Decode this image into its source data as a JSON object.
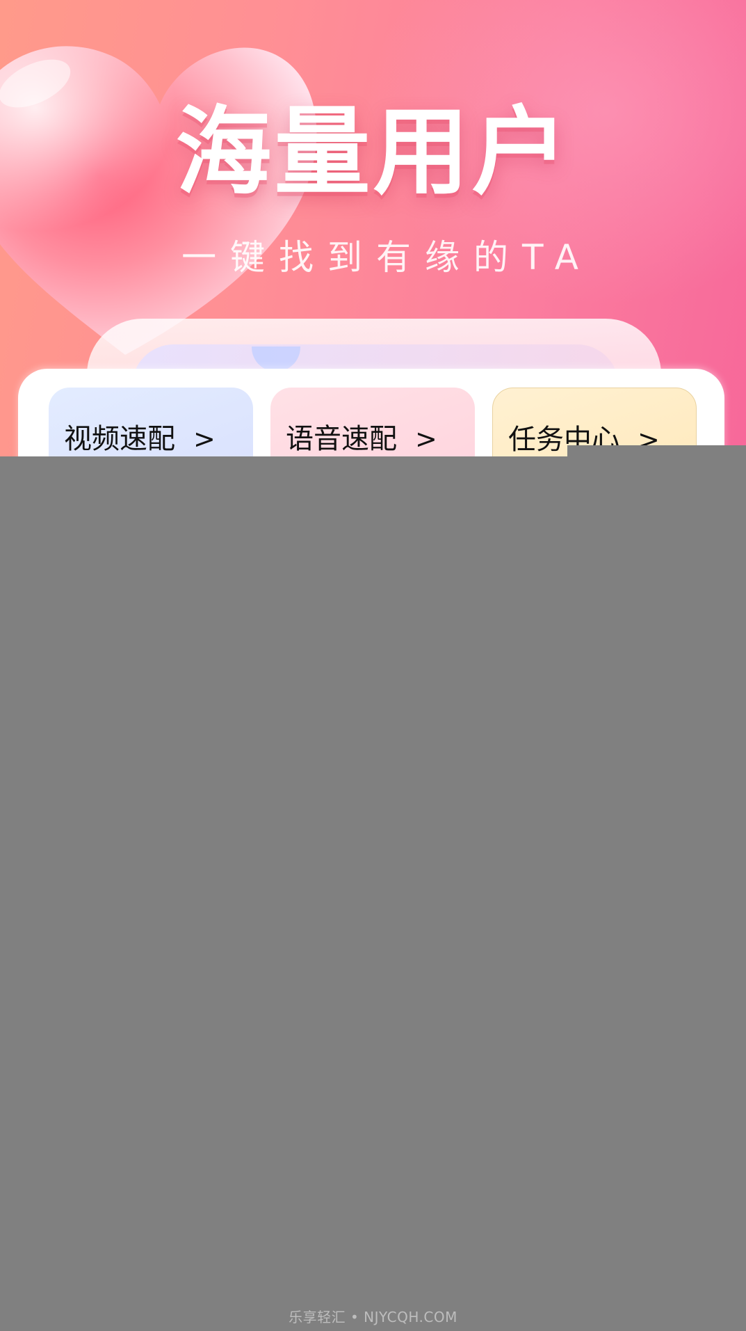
{
  "hero": {
    "title": "海量用户",
    "subtitle": "一键找到有缘的TA"
  },
  "features": [
    {
      "label": "视频速配",
      "arrow": ">"
    },
    {
      "label": "语音速配",
      "arrow": ">"
    },
    {
      "label": "任务中心",
      "arrow": ">"
    }
  ],
  "watermark": "乐享轻汇 • NJYCQH.COM",
  "colors": {
    "hero_start": "#ff9a8a",
    "hero_end": "#f7689a",
    "overlay_gray": "#808080",
    "tile_video": "#dde6ff",
    "tile_voice": "#ffd8e0",
    "tile_task": "#ffedc5"
  }
}
